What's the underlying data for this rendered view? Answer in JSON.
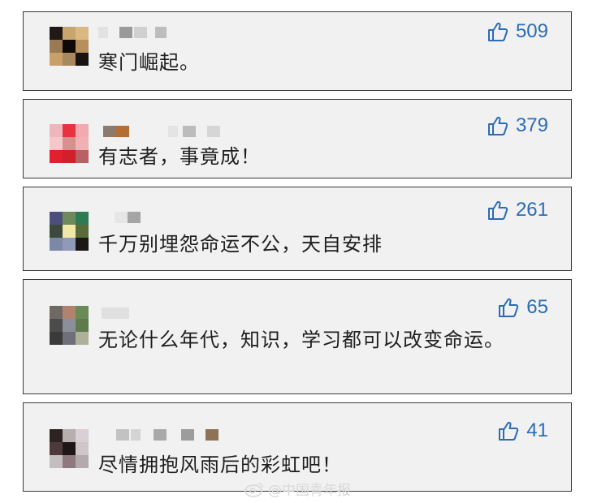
{
  "comments": [
    {
      "text": "寒门崛起。",
      "likes": "509"
    },
    {
      "text": "有志者，事竟成！",
      "likes": "379"
    },
    {
      "text": "千万别埋怨命运不公，天自安排",
      "likes": "261"
    },
    {
      "text": "无论什么年代，知识，学习都可以改变命运。",
      "likes": "65"
    },
    {
      "text": "尽情拥抱风雨后的彩虹吧！",
      "likes": "41"
    }
  ],
  "watermark": "@中国青年报",
  "colors": {
    "like": "#2b6cb5",
    "card_bg": "#f1f1f1",
    "border": "#3a3a3a"
  },
  "icons": {
    "like": "thumbs-up-icon",
    "watermark_logo": "weibo-icon"
  }
}
